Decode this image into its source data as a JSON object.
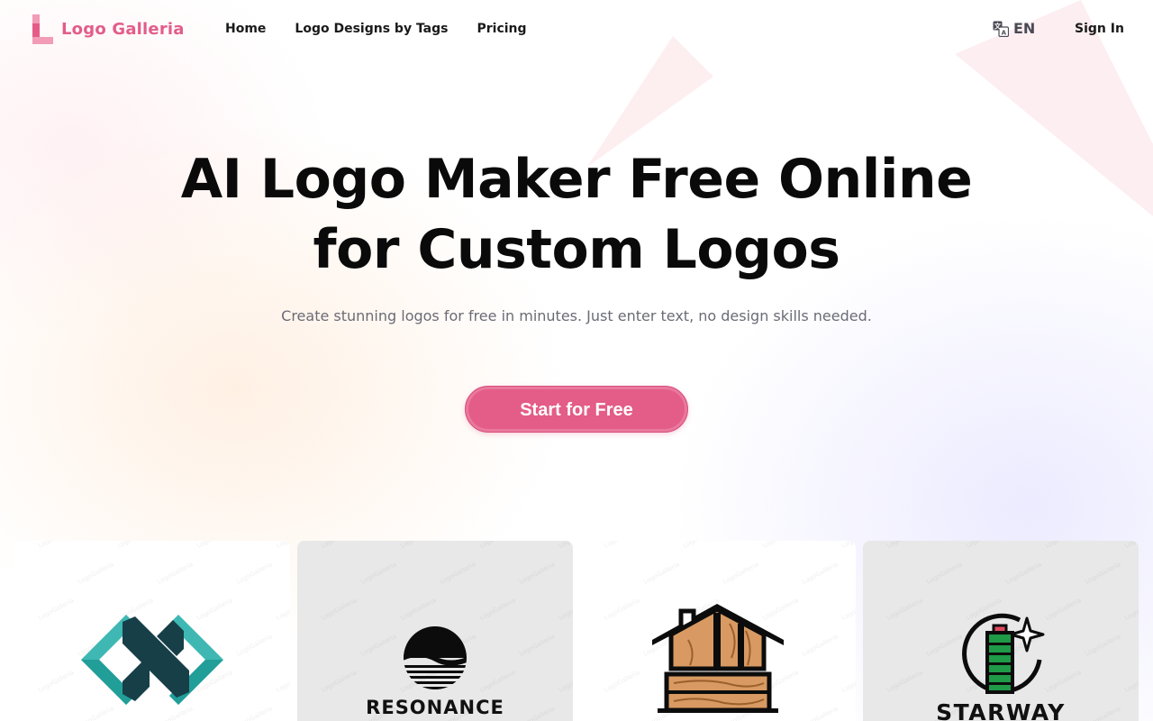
{
  "brand": {
    "name": "Logo Galleria"
  },
  "nav": {
    "items": [
      {
        "label": "Home"
      },
      {
        "label": "Logo Designs by Tags"
      },
      {
        "label": "Pricing"
      }
    ]
  },
  "header": {
    "language": "EN",
    "signin_label": "Sign In"
  },
  "hero": {
    "title_line1": "AI Logo Maker Free Online",
    "title_line2": "for Custom Logos",
    "subtitle": "Create stunning logos for free in minutes. Just enter text, no design skills needed.",
    "cta_label": "Start for Free"
  },
  "gallery": {
    "watermark": "LogoGalleria",
    "cards": [
      {
        "name": "",
        "icon": "teal-interlocking-n-icon"
      },
      {
        "name": "RESONANCE",
        "icon": "sun-over-waves-icon"
      },
      {
        "name": "",
        "icon": "wooden-house-icon"
      },
      {
        "name": "STARWAY",
        "icon": "battery-star-icon"
      }
    ]
  },
  "colors": {
    "brand_pink": "#e25d8a",
    "cta_pink": "#e45c88",
    "text_dark": "#0a0a0a",
    "text_muted": "#6b6b76",
    "card_gray": "#e8e8e8"
  }
}
